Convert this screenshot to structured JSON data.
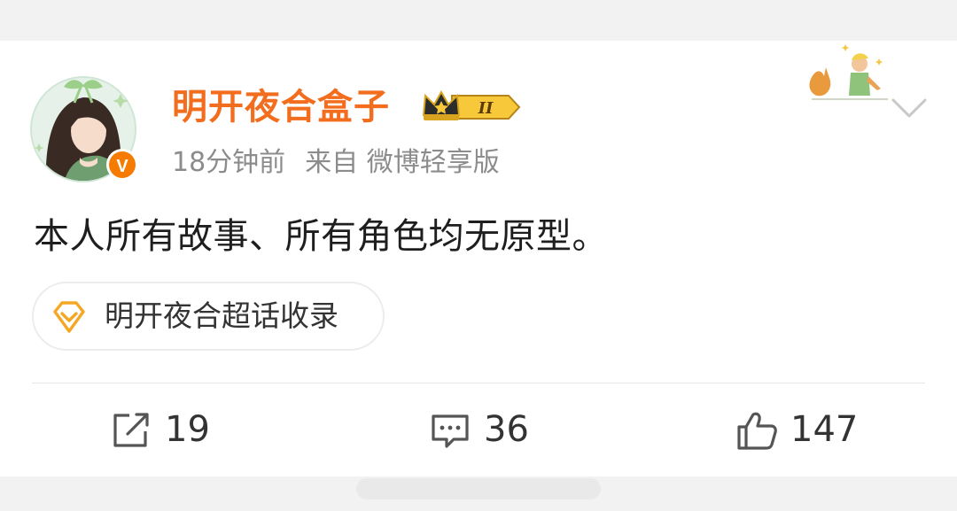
{
  "post": {
    "author": {
      "name": "明开夜合盒子",
      "verified_mark": "V",
      "crown_level": "II"
    },
    "time": "18分钟前",
    "source": "来自 微博轻享版",
    "text": "本人所有故事、所有角色均无原型。",
    "topic": {
      "label": "明开夜合超话收录",
      "icon": "diamond-icon"
    },
    "actions": {
      "repost": {
        "icon": "repost-icon",
        "count": "19"
      },
      "comment": {
        "icon": "comment-icon",
        "count": "36"
      },
      "like": {
        "icon": "thumbs-up-icon",
        "count": "147"
      }
    }
  },
  "colors": {
    "username": "#f36d1f",
    "meta_text": "#8c8c8c",
    "body_text": "#1e1e1e",
    "topic_icon": "#f5a623",
    "verified_badge": "#f57c00",
    "background": "#f2f2f2"
  }
}
